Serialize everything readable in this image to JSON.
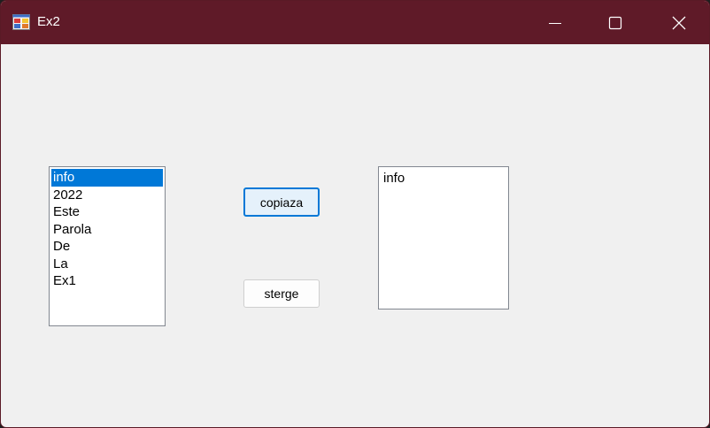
{
  "window": {
    "title": "Ex2",
    "app_icon": "winforms-app-icon"
  },
  "titlebar_controls": [
    "minimize-icon",
    "maximize-icon",
    "close-icon"
  ],
  "left_list": {
    "items": [
      "info",
      "2022",
      "Este",
      "Parola",
      "De",
      "La",
      "Ex1"
    ],
    "selected": "info"
  },
  "right_list": {
    "items": [
      "info"
    ]
  },
  "buttons": {
    "copy_label": "copiaza",
    "delete_label": "sterge"
  },
  "colors": {
    "titlebar": "#5f1a28",
    "selection": "#0078d7",
    "window_bg": "#f0f0f0"
  }
}
